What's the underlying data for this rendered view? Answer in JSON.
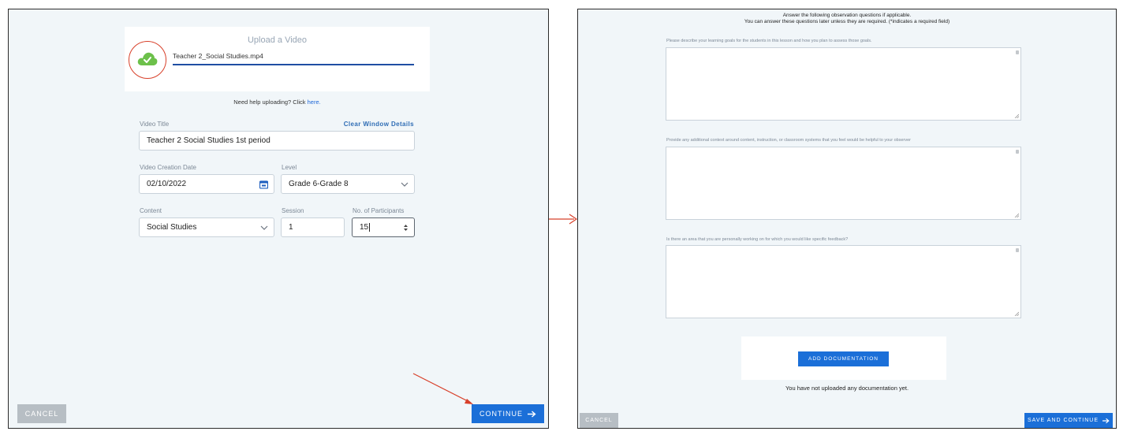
{
  "left": {
    "upload_title": "Upload a Video",
    "file_name": "Teacher 2_Social Studies.mp4",
    "upload_progress_percent": 100,
    "help_prefix": "Need help uploading? Click ",
    "help_link": "here.",
    "video_title_label": "Video Title",
    "clear_details": "Clear Window Details",
    "video_title_value": "Teacher 2 Social Studies 1st period",
    "creation_date_label": "Video Creation Date",
    "creation_date_value": "02/10/2022",
    "level_label": "Level",
    "level_value": "Grade 6-Grade 8",
    "content_label": "Content",
    "content_value": "Social Studies",
    "session_label": "Session",
    "session_value": "1",
    "participants_label": "No. of Participants",
    "participants_value": "15",
    "cancel": "CANCEL",
    "continue": "CONTINUE"
  },
  "right": {
    "header_line1": "Answer the following observation questions if applicable.",
    "header_line2": "You can answer these questions later unless they are required. (*indicates a required field)",
    "questions": [
      "Please describe your learning goals for the students in this lesson and how you plan to assess those goals.",
      "Provide any additional context around content, instruction, or classroom systems that you feel would be helpful to your observer",
      "Is there an area that you are personally working on for which you would like specific feedback?"
    ],
    "add_documentation": "ADD DOCUMENTATION",
    "no_docs": "You have not uploaded any documentation yet.",
    "cancel": "CANCEL",
    "save_continue": "SAVE AND CONTINUE"
  },
  "colors": {
    "panel_bg": "#f1f6f9",
    "primary": "#1b6fd8",
    "cancel": "#b7bec4",
    "progress": "#1f4ea3",
    "cloud": "#6cc04a",
    "annotation": "#d8402a"
  },
  "icons": [
    "cloud-check-icon",
    "calendar-icon",
    "chevron-down-icon",
    "spinner-arrows-icon",
    "arrow-right-icon",
    "resize-grip-icon"
  ]
}
